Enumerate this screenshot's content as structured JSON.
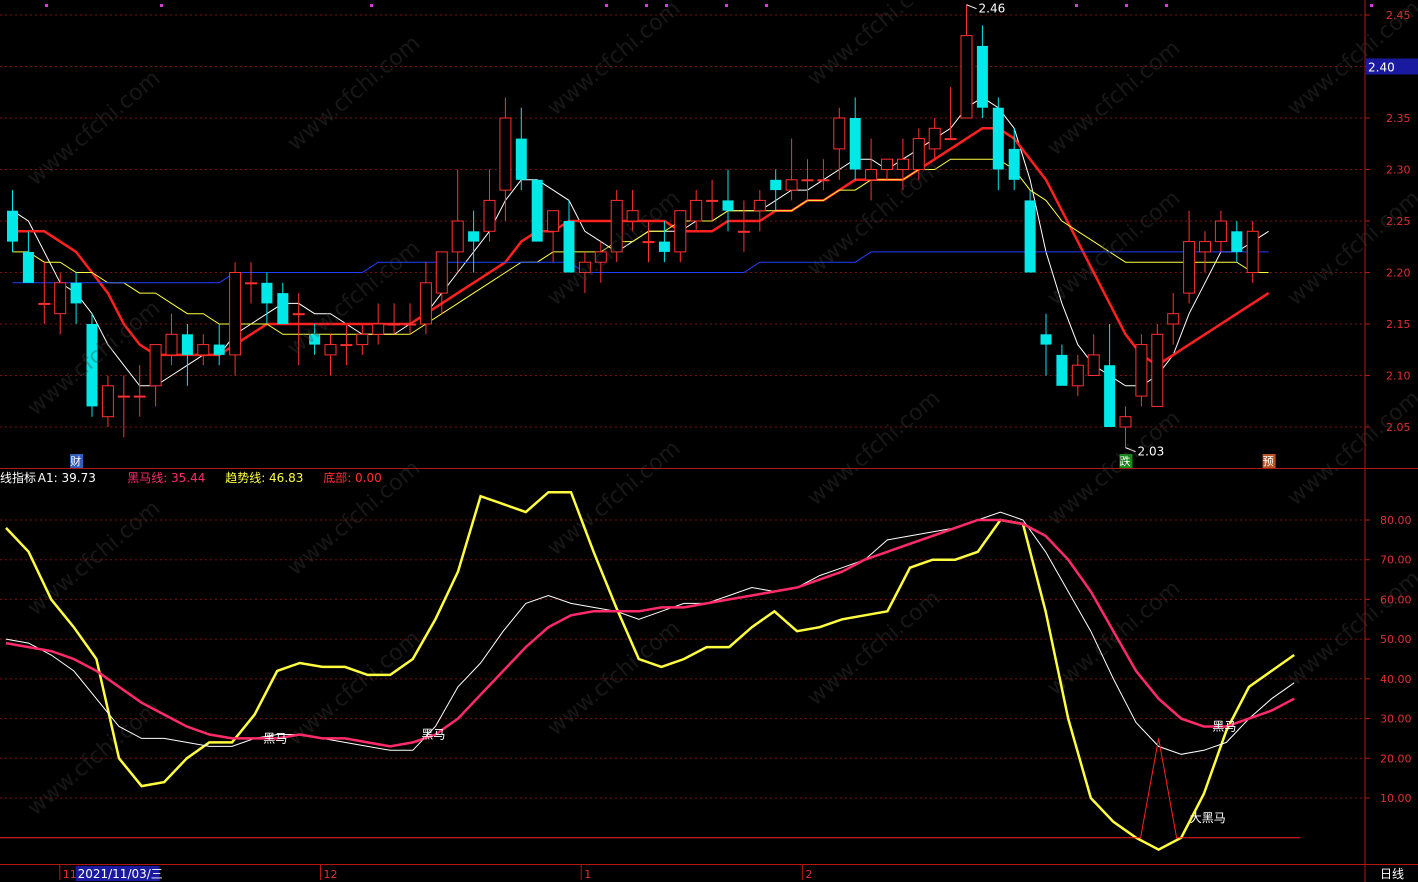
{
  "chart_data": [
    {
      "type": "candlestick",
      "price_axis": {
        "ticks": [
          "2.45",
          "2.40",
          "2.35",
          "2.30",
          "2.25",
          "2.20",
          "2.15",
          "2.10",
          "2.05"
        ],
        "ylim": [
          2.015,
          2.465
        ],
        "current_price": "2.40"
      },
      "high_marker": "2.46",
      "low_marker": "2.03",
      "event_tags": [
        {
          "text": "财",
          "index": 4,
          "color": "#3a6edc"
        },
        {
          "text": "跌",
          "index": 70,
          "color": "#1aa81a"
        },
        {
          "text": "预",
          "index": 79,
          "color": "#d9622a"
        }
      ],
      "candles": [
        {
          "o": 2.26,
          "h": 2.28,
          "l": 2.22,
          "c": 2.23
        },
        {
          "o": 2.22,
          "h": 2.24,
          "l": 2.19,
          "c": 2.19
        },
        {
          "o": 2.17,
          "h": 2.21,
          "l": 2.15,
          "c": 2.17
        },
        {
          "o": 2.16,
          "h": 2.2,
          "l": 2.14,
          "c": 2.19
        },
        {
          "o": 2.19,
          "h": 2.2,
          "l": 2.15,
          "c": 2.17
        },
        {
          "o": 2.15,
          "h": 2.16,
          "l": 2.06,
          "c": 2.07
        },
        {
          "o": 2.06,
          "h": 2.1,
          "l": 2.05,
          "c": 2.09
        },
        {
          "o": 2.08,
          "h": 2.1,
          "l": 2.04,
          "c": 2.08
        },
        {
          "o": 2.08,
          "h": 2.11,
          "l": 2.06,
          "c": 2.08
        },
        {
          "o": 2.09,
          "h": 2.13,
          "l": 2.07,
          "c": 2.13
        },
        {
          "o": 2.12,
          "h": 2.16,
          "l": 2.11,
          "c": 2.14
        },
        {
          "o": 2.14,
          "h": 2.15,
          "l": 2.09,
          "c": 2.12
        },
        {
          "o": 2.12,
          "h": 2.14,
          "l": 2.11,
          "c": 2.13
        },
        {
          "o": 2.13,
          "h": 2.15,
          "l": 2.11,
          "c": 2.12
        },
        {
          "o": 2.12,
          "h": 2.21,
          "l": 2.1,
          "c": 2.2
        },
        {
          "o": 2.19,
          "h": 2.21,
          "l": 2.17,
          "c": 2.19
        },
        {
          "o": 2.19,
          "h": 2.2,
          "l": 2.15,
          "c": 2.17
        },
        {
          "o": 2.18,
          "h": 2.19,
          "l": 2.15,
          "c": 2.15
        },
        {
          "o": 2.16,
          "h": 2.18,
          "l": 2.11,
          "c": 2.16
        },
        {
          "o": 2.14,
          "h": 2.15,
          "l": 2.12,
          "c": 2.13
        },
        {
          "o": 2.12,
          "h": 2.14,
          "l": 2.1,
          "c": 2.13
        },
        {
          "o": 2.13,
          "h": 2.15,
          "l": 2.11,
          "c": 2.13
        },
        {
          "o": 2.13,
          "h": 2.15,
          "l": 2.12,
          "c": 2.14
        },
        {
          "o": 2.14,
          "h": 2.17,
          "l": 2.13,
          "c": 2.15
        },
        {
          "o": 2.15,
          "h": 2.17,
          "l": 2.14,
          "c": 2.15
        },
        {
          "o": 2.15,
          "h": 2.17,
          "l": 2.14,
          "c": 2.15
        },
        {
          "o": 2.15,
          "h": 2.21,
          "l": 2.14,
          "c": 2.19
        },
        {
          "o": 2.18,
          "h": 2.21,
          "l": 2.16,
          "c": 2.22
        },
        {
          "o": 2.22,
          "h": 2.3,
          "l": 2.2,
          "c": 2.25
        },
        {
          "o": 2.24,
          "h": 2.26,
          "l": 2.2,
          "c": 2.23
        },
        {
          "o": 2.24,
          "h": 2.3,
          "l": 2.23,
          "c": 2.27
        },
        {
          "o": 2.28,
          "h": 2.37,
          "l": 2.25,
          "c": 2.35
        },
        {
          "o": 2.33,
          "h": 2.36,
          "l": 2.28,
          "c": 2.29
        },
        {
          "o": 2.29,
          "h": 2.29,
          "l": 2.25,
          "c": 2.23
        },
        {
          "o": 2.24,
          "h": 2.26,
          "l": 2.21,
          "c": 2.26
        },
        {
          "o": 2.25,
          "h": 2.27,
          "l": 2.2,
          "c": 2.2
        },
        {
          "o": 2.2,
          "h": 2.22,
          "l": 2.18,
          "c": 2.21
        },
        {
          "o": 2.21,
          "h": 2.23,
          "l": 2.19,
          "c": 2.22
        },
        {
          "o": 2.22,
          "h": 2.28,
          "l": 2.21,
          "c": 2.27
        },
        {
          "o": 2.25,
          "h": 2.28,
          "l": 2.24,
          "c": 2.26
        },
        {
          "o": 2.23,
          "h": 2.25,
          "l": 2.21,
          "c": 2.23
        },
        {
          "o": 2.23,
          "h": 2.25,
          "l": 2.21,
          "c": 2.22
        },
        {
          "o": 2.22,
          "h": 2.26,
          "l": 2.21,
          "c": 2.26
        },
        {
          "o": 2.25,
          "h": 2.28,
          "l": 2.24,
          "c": 2.27
        },
        {
          "o": 2.27,
          "h": 2.29,
          "l": 2.25,
          "c": 2.27
        },
        {
          "o": 2.27,
          "h": 2.3,
          "l": 2.24,
          "c": 2.26
        },
        {
          "o": 2.24,
          "h": 2.27,
          "l": 2.22,
          "c": 2.24
        },
        {
          "o": 2.26,
          "h": 2.28,
          "l": 2.24,
          "c": 2.27
        },
        {
          "o": 2.29,
          "h": 2.3,
          "l": 2.26,
          "c": 2.28
        },
        {
          "o": 2.28,
          "h": 2.33,
          "l": 2.27,
          "c": 2.29
        },
        {
          "o": 2.29,
          "h": 2.31,
          "l": 2.27,
          "c": 2.29
        },
        {
          "o": 2.29,
          "h": 2.31,
          "l": 2.28,
          "c": 2.29
        },
        {
          "o": 2.32,
          "h": 2.36,
          "l": 2.29,
          "c": 2.35
        },
        {
          "o": 2.35,
          "h": 2.37,
          "l": 2.29,
          "c": 2.3
        },
        {
          "o": 2.29,
          "h": 2.33,
          "l": 2.27,
          "c": 2.3
        },
        {
          "o": 2.3,
          "h": 2.31,
          "l": 2.29,
          "c": 2.31
        },
        {
          "o": 2.3,
          "h": 2.33,
          "l": 2.28,
          "c": 2.31
        },
        {
          "o": 2.3,
          "h": 2.34,
          "l": 2.29,
          "c": 2.33
        },
        {
          "o": 2.32,
          "h": 2.35,
          "l": 2.31,
          "c": 2.34
        },
        {
          "o": 2.33,
          "h": 2.38,
          "l": 2.33,
          "c": 2.33
        },
        {
          "o": 2.35,
          "h": 2.46,
          "l": 2.35,
          "c": 2.43
        },
        {
          "o": 2.42,
          "h": 2.44,
          "l": 2.35,
          "c": 2.36
        },
        {
          "o": 2.36,
          "h": 2.37,
          "l": 2.28,
          "c": 2.3
        },
        {
          "o": 2.32,
          "h": 2.34,
          "l": 2.28,
          "c": 2.29
        },
        {
          "o": 2.27,
          "h": 2.28,
          "l": 2.2,
          "c": 2.2
        },
        {
          "o": 2.14,
          "h": 2.16,
          "l": 2.1,
          "c": 2.13
        },
        {
          "o": 2.12,
          "h": 2.13,
          "l": 2.09,
          "c": 2.09
        },
        {
          "o": 2.09,
          "h": 2.12,
          "l": 2.08,
          "c": 2.11
        },
        {
          "o": 2.1,
          "h": 2.14,
          "l": 2.1,
          "c": 2.12
        },
        {
          "o": 2.11,
          "h": 2.15,
          "l": 2.05,
          "c": 2.05
        },
        {
          "o": 2.05,
          "h": 2.07,
          "l": 2.03,
          "c": 2.06
        },
        {
          "o": 2.08,
          "h": 2.14,
          "l": 2.07,
          "c": 2.13
        },
        {
          "o": 2.07,
          "h": 2.15,
          "l": 2.07,
          "c": 2.14
        },
        {
          "o": 2.15,
          "h": 2.18,
          "l": 2.13,
          "c": 2.16
        },
        {
          "o": 2.18,
          "h": 2.26,
          "l": 2.17,
          "c": 2.23
        },
        {
          "o": 2.22,
          "h": 2.24,
          "l": 2.2,
          "c": 2.23
        },
        {
          "o": 2.23,
          "h": 2.26,
          "l": 2.22,
          "c": 2.25
        },
        {
          "o": 2.24,
          "h": 2.25,
          "l": 2.21,
          "c": 2.22
        },
        {
          "o": 2.2,
          "h": 2.25,
          "l": 2.19,
          "c": 2.24
        }
      ],
      "moving_averages": [
        {
          "color": "#ffffff",
          "values": [
            2.26,
            2.25,
            2.22,
            2.19,
            2.18,
            2.16,
            2.13,
            2.11,
            2.09,
            2.09,
            2.1,
            2.11,
            2.12,
            2.12,
            2.14,
            2.15,
            2.16,
            2.17,
            2.17,
            2.16,
            2.16,
            2.15,
            2.14,
            2.14,
            2.14,
            2.15,
            2.16,
            2.18,
            2.2,
            2.22,
            2.24,
            2.27,
            2.29,
            2.29,
            2.28,
            2.27,
            2.24,
            2.23,
            2.22,
            2.23,
            2.24,
            2.24,
            2.24,
            2.25,
            2.25,
            2.26,
            2.26,
            2.26,
            2.27,
            2.28,
            2.28,
            2.29,
            2.3,
            2.31,
            2.31,
            2.3,
            2.31,
            2.32,
            2.33,
            2.34,
            2.36,
            2.37,
            2.36,
            2.34,
            2.29,
            2.22,
            2.17,
            2.13,
            2.11,
            2.1,
            2.09,
            2.09,
            2.1,
            2.12,
            2.16,
            2.19,
            2.22,
            2.22,
            2.23,
            2.24
          ]
        },
        {
          "color": "#ff2020",
          "values": [
            2.24,
            2.24,
            2.24,
            2.23,
            2.22,
            2.2,
            2.18,
            2.15,
            2.13,
            2.12,
            2.12,
            2.12,
            2.12,
            2.12,
            2.13,
            2.14,
            2.15,
            2.15,
            2.15,
            2.15,
            2.15,
            2.15,
            2.15,
            2.15,
            2.15,
            2.15,
            2.16,
            2.17,
            2.18,
            2.19,
            2.2,
            2.21,
            2.23,
            2.24,
            2.24,
            2.25,
            2.25,
            2.25,
            2.25,
            2.25,
            2.25,
            2.25,
            2.24,
            2.24,
            2.24,
            2.25,
            2.25,
            2.25,
            2.26,
            2.26,
            2.27,
            2.27,
            2.28,
            2.29,
            2.29,
            2.29,
            2.29,
            2.3,
            2.31,
            2.32,
            2.33,
            2.34,
            2.34,
            2.33,
            2.31,
            2.29,
            2.26,
            2.23,
            2.2,
            2.17,
            2.14,
            2.12,
            2.11,
            2.12,
            2.13,
            2.14,
            2.15,
            2.16,
            2.17,
            2.18
          ]
        },
        {
          "color": "#ffff40",
          "values": [
            2.22,
            2.22,
            2.21,
            2.21,
            2.2,
            2.2,
            2.19,
            2.19,
            2.18,
            2.18,
            2.17,
            2.16,
            2.16,
            2.15,
            2.15,
            2.15,
            2.15,
            2.14,
            2.14,
            2.14,
            2.14,
            2.14,
            2.14,
            2.14,
            2.14,
            2.14,
            2.15,
            2.16,
            2.17,
            2.18,
            2.19,
            2.2,
            2.21,
            2.21,
            2.22,
            2.22,
            2.22,
            2.22,
            2.23,
            2.23,
            2.24,
            2.24,
            2.25,
            2.25,
            2.25,
            2.26,
            2.26,
            2.26,
            2.26,
            2.26,
            2.27,
            2.27,
            2.28,
            2.28,
            2.29,
            2.29,
            2.29,
            2.3,
            2.3,
            2.31,
            2.31,
            2.31,
            2.31,
            2.3,
            2.28,
            2.27,
            2.25,
            2.24,
            2.23,
            2.22,
            2.21,
            2.21,
            2.21,
            2.21,
            2.21,
            2.21,
            2.21,
            2.21,
            2.2,
            2.2
          ]
        },
        {
          "color": "#2040ff",
          "values": [
            2.19,
            2.19,
            2.19,
            2.19,
            2.19,
            2.19,
            2.19,
            2.19,
            2.19,
            2.19,
            2.19,
            2.19,
            2.19,
            2.19,
            2.2,
            2.2,
            2.2,
            2.2,
            2.2,
            2.2,
            2.2,
            2.2,
            2.2,
            2.21,
            2.21,
            2.21,
            2.21,
            2.21,
            2.21,
            2.21,
            2.21,
            2.21,
            2.21,
            2.21,
            2.21,
            2.21,
            2.2,
            2.2,
            2.2,
            2.2,
            2.2,
            2.2,
            2.2,
            2.2,
            2.2,
            2.2,
            2.2,
            2.21,
            2.21,
            2.21,
            2.21,
            2.21,
            2.21,
            2.21,
            2.22,
            2.22,
            2.22,
            2.22,
            2.22,
            2.22,
            2.22,
            2.22,
            2.22,
            2.22,
            2.22,
            2.22,
            2.22,
            2.22,
            2.22,
            2.22,
            2.22,
            2.22,
            2.22,
            2.22,
            2.22,
            2.22,
            2.22,
            2.22,
            2.22,
            2.22
          ]
        }
      ]
    },
    {
      "type": "line",
      "header": [
        {
          "text": "线指标",
          "color": "#ffffff"
        },
        {
          "text": "A1: 39.73",
          "color": "#ffffff"
        },
        {
          "text": "黑马线: 35.44",
          "color": "#ff2a6a"
        },
        {
          "text": "趋势线: 46.83",
          "color": "#ffff40"
        },
        {
          "text": "底部: 0.00",
          "color": "#ff3030"
        }
      ],
      "y_ticks": [
        "80.00",
        "70.00",
        "60.00",
        "50.00",
        "40.00",
        "30.00",
        "20.00",
        "10.00"
      ],
      "ylim": [
        -6,
        90
      ],
      "series": [
        {
          "color": "#ffff40",
          "values": [
            78,
            72,
            60,
            53,
            45,
            20,
            13,
            14,
            20,
            24,
            24,
            31,
            42,
            44,
            43,
            43,
            41,
            41,
            45,
            55,
            67,
            86,
            84,
            82,
            87,
            87,
            72,
            58,
            45,
            43,
            45,
            48,
            48,
            53,
            57,
            52,
            53,
            55,
            56,
            57,
            68,
            70,
            70,
            72,
            80,
            79,
            57,
            30,
            10,
            4,
            0,
            -3,
            0,
            11,
            27,
            38,
            42,
            46
          ]
        },
        {
          "color": "#ffffff",
          "values": [
            50,
            49,
            46,
            42,
            35,
            28,
            25,
            25,
            24,
            23,
            23,
            25,
            26,
            26,
            25,
            24,
            23,
            22,
            22,
            28,
            38,
            44,
            52,
            59,
            61,
            59,
            58,
            57,
            55,
            57,
            59,
            59,
            61,
            63,
            62,
            63,
            66,
            68,
            70,
            75,
            76,
            77,
            78,
            80,
            82,
            80,
            72,
            62,
            52,
            40,
            29,
            23,
            21,
            22,
            24,
            30,
            35,
            39
          ]
        },
        {
          "color": "#ff2a6a",
          "values": [
            49,
            48,
            47,
            45,
            42,
            38,
            34,
            31,
            28,
            26,
            25,
            25,
            25,
            26,
            25,
            25,
            24,
            23,
            24,
            26,
            30,
            36,
            42,
            48,
            53,
            56,
            57,
            57,
            57,
            58,
            58,
            59,
            60,
            61,
            62,
            63,
            65,
            67,
            70,
            72,
            74,
            76,
            78,
            80,
            80,
            79,
            76,
            70,
            62,
            52,
            42,
            35,
            30,
            28,
            28,
            30,
            32,
            35
          ]
        }
      ],
      "labels": [
        {
          "text": "黑马",
          "index": 12
        },
        {
          "text": "黑马",
          "index": 19
        },
        {
          "text": "黑马",
          "index": 54
        },
        {
          "text": "大黑马",
          "index": 53
        }
      ],
      "bottom_signal": {
        "spike_index": 51,
        "spike_value": 25
      }
    }
  ],
  "time_axis": {
    "labels": [
      {
        "text": "11",
        "index": 7
      },
      {
        "text": "2021/11/03/三",
        "index": 9,
        "highlight": true
      },
      {
        "text": "12",
        "index": 40
      },
      {
        "text": "1",
        "index": 73
      },
      {
        "text": "2",
        "index": 101
      }
    ],
    "period": "日线"
  },
  "top_markers": {
    "color": "#d040d0"
  },
  "watermark": "www.cfchi.com"
}
